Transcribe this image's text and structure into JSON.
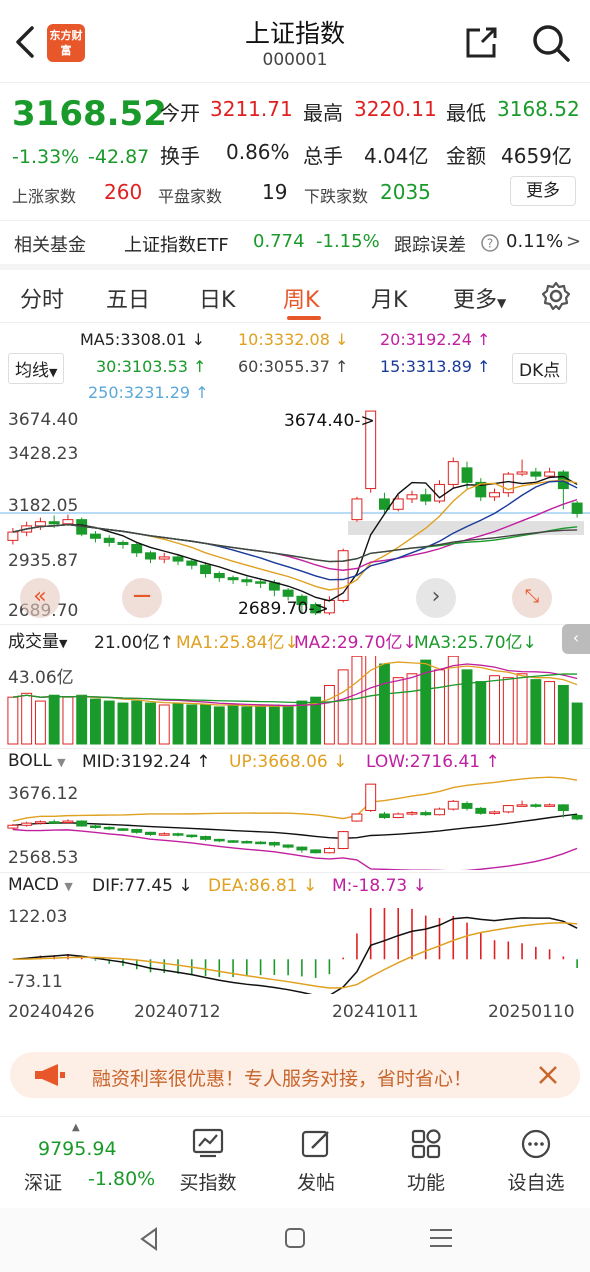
{
  "header": {
    "title": "上证指数",
    "code": "000001",
    "logo_text": "东方财富"
  },
  "quote": {
    "price": "3168.52",
    "change_pct": "-1.33%",
    "change": "-42.87",
    "open_label": "今开",
    "open": "3211.71",
    "high_label": "最高",
    "high": "3220.11",
    "low_label": "最低",
    "low": "3168.52",
    "turnover_label": "换手",
    "turnover": "0.86%",
    "volume_label": "总手",
    "volume": "4.04亿",
    "amount_label": "金额",
    "amount": "4659亿",
    "up_label": "上涨家数",
    "up": "260",
    "flat_label": "平盘家数",
    "flat": "19",
    "down_label": "下跌家数",
    "down": "2035",
    "more_label": "更多"
  },
  "fund": {
    "label": "相关基金",
    "name": "上证指数ETF",
    "price": "0.774",
    "pct": "-1.15%",
    "track_label": "跟踪误差",
    "track": "0.11%",
    "arrow": ">"
  },
  "tabs": [
    "分时",
    "五日",
    "日K",
    "周K",
    "月K",
    "更多"
  ],
  "active_tab": "周K",
  "ma": {
    "ma5": "MA5:3308.01",
    "ma5_arrow": "↓",
    "ma10": "10:3332.08",
    "ma10_arrow": "↓",
    "ma20": "20:3192.24",
    "ma20_arrow": "↑",
    "ma30": "30:3103.53",
    "ma30_arrow": "↑",
    "ma60": "60:3055.37",
    "ma60_arrow": "↑",
    "ma15": "15:3313.89",
    "ma15_arrow": "↑",
    "ma250": "250:3231.29",
    "ma250_arrow": "↑",
    "selector": "均线",
    "dk": "DK点"
  },
  "kline_axis": {
    "y1": "3674.40",
    "y2": "3428.23",
    "y3": "3182.05",
    "y4": "2935.87",
    "y5": "2689.70",
    "hi_mark": "3674.40",
    "lo_mark": "2689.70"
  },
  "volume": {
    "label": "成交量",
    "value": "21.00亿",
    "value_arrow": "↑",
    "ma1": "MA1:25.84亿",
    "ma1_arrow": "↓",
    "ma2": "MA2:29.70亿",
    "ma2_arrow": "↓",
    "ma3": "MA3:25.70亿",
    "ma3_arrow": "↓",
    "axis_top": "43.06亿"
  },
  "boll": {
    "label": "BOLL",
    "mid": "MID:3192.24",
    "mid_arrow": "↑",
    "up": "UP:3668.06",
    "up_arrow": "↓",
    "low": "LOW:2716.41",
    "low_arrow": "↑",
    "axis_top": "3676.12",
    "axis_bot": "2568.53"
  },
  "macd": {
    "label": "MACD",
    "dif": "DIF:77.45",
    "dif_arrow": "↓",
    "dea": "DEA:86.81",
    "dea_arrow": "↓",
    "m": "M:-18.73",
    "m_arrow": "↓",
    "axis_top": "122.03",
    "axis_bot": "-73.11"
  },
  "dates": [
    "20240426",
    "20240712",
    "20241011",
    "20250110"
  ],
  "banner": {
    "text": "融资利率很优惠！专人服务对接，省时省心！"
  },
  "bottom": {
    "sz_value": "9795.94",
    "sz_label": "深证",
    "sz_pct": "-1.80%",
    "items": [
      "买指数",
      "发帖",
      "功能",
      "设自选"
    ]
  },
  "chart_data": {
    "type": "candlestick",
    "note_series": [
      "weekly index candles"
    ],
    "candles": [
      {
        "o": 3050,
        "c": 3090,
        "h": 3110,
        "l": 3030
      },
      {
        "o": 3090,
        "c": 3120,
        "h": 3140,
        "l": 3070
      },
      {
        "o": 3120,
        "c": 3140,
        "h": 3160,
        "l": 3100
      },
      {
        "o": 3140,
        "c": 3130,
        "h": 3170,
        "l": 3110
      },
      {
        "o": 3130,
        "c": 3150,
        "h": 3174,
        "l": 3120
      },
      {
        "o": 3150,
        "c": 3080,
        "h": 3160,
        "l": 3070
      },
      {
        "o": 3080,
        "c": 3060,
        "h": 3095,
        "l": 3040
      },
      {
        "o": 3060,
        "c": 3040,
        "h": 3075,
        "l": 3020
      },
      {
        "o": 3040,
        "c": 3030,
        "h": 3050,
        "l": 3010
      },
      {
        "o": 3030,
        "c": 2990,
        "h": 3040,
        "l": 2970
      },
      {
        "o": 2990,
        "c": 2960,
        "h": 3000,
        "l": 2940
      },
      {
        "o": 2960,
        "c": 2970,
        "h": 2990,
        "l": 2940
      },
      {
        "o": 2970,
        "c": 2950,
        "h": 2985,
        "l": 2930
      },
      {
        "o": 2950,
        "c": 2930,
        "h": 2960,
        "l": 2910
      },
      {
        "o": 2930,
        "c": 2890,
        "h": 2945,
        "l": 2870
      },
      {
        "o": 2890,
        "c": 2870,
        "h": 2900,
        "l": 2850
      },
      {
        "o": 2870,
        "c": 2860,
        "h": 2880,
        "l": 2840
      },
      {
        "o": 2860,
        "c": 2850,
        "h": 2875,
        "l": 2830
      },
      {
        "o": 2850,
        "c": 2845,
        "h": 2865,
        "l": 2820
      },
      {
        "o": 2845,
        "c": 2810,
        "h": 2860,
        "l": 2780
      },
      {
        "o": 2810,
        "c": 2780,
        "h": 2820,
        "l": 2760
      },
      {
        "o": 2780,
        "c": 2740,
        "h": 2790,
        "l": 2700
      },
      {
        "o": 2740,
        "c": 2700,
        "h": 2750,
        "l": 2690
      },
      {
        "o": 2700,
        "c": 2760,
        "h": 2780,
        "l": 2690
      },
      {
        "o": 2760,
        "c": 3000,
        "h": 3010,
        "l": 2750
      },
      {
        "o": 3150,
        "c": 3250,
        "h": 3260,
        "l": 3140
      },
      {
        "o": 3300,
        "c": 3674,
        "h": 3674,
        "l": 3280
      },
      {
        "o": 3250,
        "c": 3200,
        "h": 3280,
        "l": 3180
      },
      {
        "o": 3200,
        "c": 3250,
        "h": 3270,
        "l": 3190
      },
      {
        "o": 3250,
        "c": 3270,
        "h": 3290,
        "l": 3230
      },
      {
        "o": 3270,
        "c": 3240,
        "h": 3300,
        "l": 3220
      },
      {
        "o": 3240,
        "c": 3320,
        "h": 3340,
        "l": 3230
      },
      {
        "o": 3320,
        "c": 3430,
        "h": 3450,
        "l": 3300
      },
      {
        "o": 3400,
        "c": 3330,
        "h": 3430,
        "l": 3300
      },
      {
        "o": 3330,
        "c": 3260,
        "h": 3350,
        "l": 3240
      },
      {
        "o": 3260,
        "c": 3280,
        "h": 3300,
        "l": 3240
      },
      {
        "o": 3280,
        "c": 3370,
        "h": 3380,
        "l": 3260
      },
      {
        "o": 3370,
        "c": 3380,
        "h": 3440,
        "l": 3360
      },
      {
        "o": 3380,
        "c": 3360,
        "h": 3400,
        "l": 3340
      },
      {
        "o": 3360,
        "c": 3380,
        "h": 3400,
        "l": 3350
      },
      {
        "o": 3380,
        "c": 3300,
        "h": 3390,
        "l": 3200
      },
      {
        "o": 3230,
        "c": 3180,
        "h": 3240,
        "l": 3160
      }
    ],
    "volumes": [
      24,
      26,
      22,
      25,
      24,
      25,
      23,
      22,
      21,
      22,
      21,
      20,
      21,
      20,
      20,
      19,
      20,
      19,
      19,
      20,
      19,
      22,
      24,
      30,
      38,
      45,
      52,
      41,
      34,
      36,
      43,
      38,
      45,
      38,
      32,
      35,
      34,
      36,
      33,
      32,
      30,
      21
    ],
    "ylim": [
      2689.7,
      3674.4
    ],
    "vol_ylim": [
      0,
      43.06
    ]
  }
}
